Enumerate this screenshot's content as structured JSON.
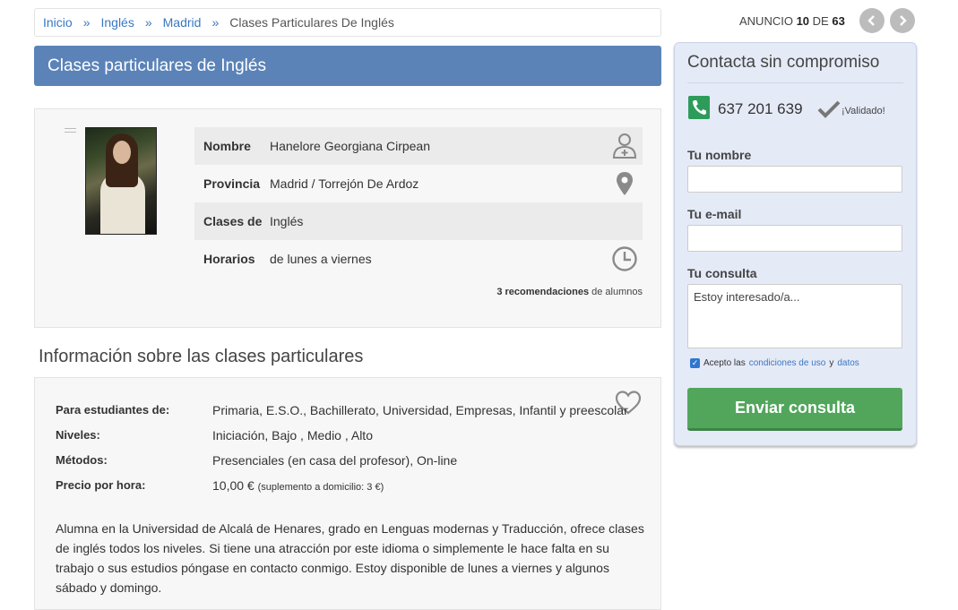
{
  "breadcrumb": {
    "items": [
      "Inicio",
      "Inglés",
      "Madrid"
    ],
    "separator": "»",
    "current": "Clases Particulares De Inglés"
  },
  "ad_nav": {
    "prefix": "ANUNCIO",
    "current": "10",
    "of": "DE",
    "total": "63",
    "prev_icon": "chevron-left-icon",
    "next_icon": "chevron-right-icon"
  },
  "title": "Clases particulares de Inglés",
  "profile": {
    "rows": [
      {
        "label": "Nombre",
        "value": "Hanelore Georgiana Cirpean",
        "icon": "user-icon"
      },
      {
        "label": "Provincia",
        "value": "Madrid / Torrejón De Ardoz",
        "icon": "map-pin-icon"
      },
      {
        "label": "Clases de",
        "value": "Inglés",
        "icon": ""
      },
      {
        "label": "Horarios",
        "value": "de lunes a viernes",
        "icon": "clock-icon"
      }
    ],
    "recommendations_bold": "3 recomendaciones",
    "recommendations_rest": "de alumnos"
  },
  "section_title": "Información sobre las clases particulares",
  "details": {
    "rows": [
      {
        "label": "Para estudiantes de:",
        "value": "Primaria, E.S.O., Bachillerato, Universidad, Empresas, Infantil y preescolar"
      },
      {
        "label": "Niveles:",
        "value": "Iniciación, Bajo , Medio , Alto"
      },
      {
        "label": "Métodos:",
        "value": "Presenciales (en casa del profesor), On-line"
      },
      {
        "label": "Precio por hora:",
        "value": "10,00 €",
        "note": "(suplemento a domicilio: 3 €)"
      }
    ],
    "description": "Alumna en la Universidad de Alcalá de Henares, grado en Lenguas modernas y Traducción, ofrece clases de inglés todos los niveles. Si tiene una atracción por este idioma o simplemente le hace falta en su trabajo o sus estudios póngase en contacto conmigo. Estoy disponible de lunes a viernes y algunos sábado y domingo."
  },
  "contact": {
    "title": "Contacta sin compromiso",
    "phone": "637 201 639",
    "validated": "¡Validado!",
    "name_label": "Tu nombre",
    "name_value": "",
    "email_label": "Tu e-mail",
    "email_value": "",
    "query_label": "Tu consulta",
    "query_value": "Estoy interesado/a...",
    "accept_prefix": "Acepto las",
    "accept_link1": "condiciones de uso",
    "accept_and": "y",
    "accept_link2": "datos",
    "accept_checked": true,
    "send_label": "Enviar consulta"
  },
  "colors": {
    "title_bar": "#5b83b8",
    "link": "#3a78c2",
    "send_button": "#52a65c",
    "contact_bg": "#e5eaf7",
    "phone_icon": "#2d9c5a"
  }
}
